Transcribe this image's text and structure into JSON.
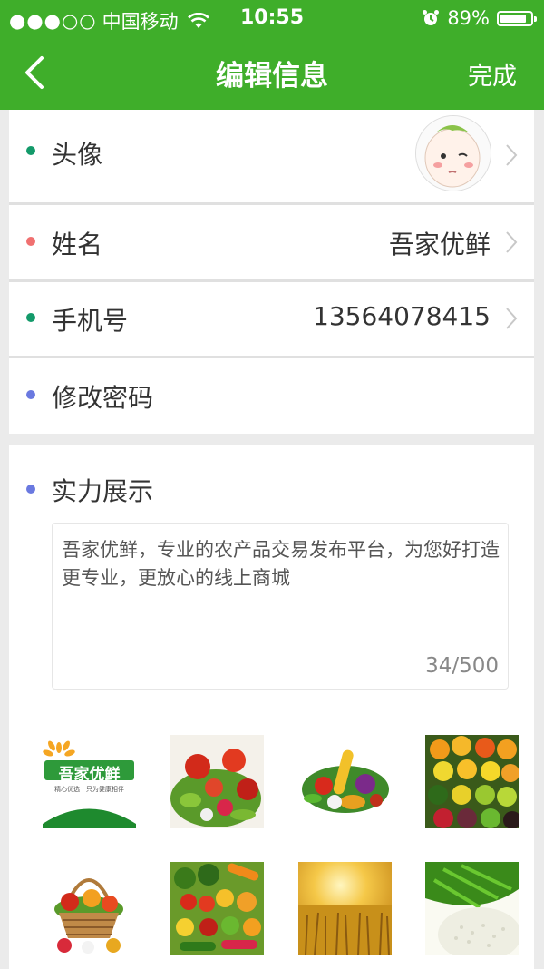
{
  "status_bar": {
    "signal_dots": "●●●○○",
    "carrier": "中国移动",
    "wifi_icon": "wifi-icon",
    "time": "10:55",
    "alarm_icon": "alarm-icon",
    "battery": "89%",
    "battery_level": 0.89
  },
  "nav": {
    "back_icon": "chevron-left-icon",
    "title": "编辑信息",
    "done_label": "完成"
  },
  "profile": {
    "rows": [
      {
        "label": "头像",
        "dot_color": "#139a6a",
        "value": "",
        "icon": "avatar"
      },
      {
        "label": "姓名",
        "dot_color": "#f07070",
        "value": "吾家优鲜"
      },
      {
        "label": "手机号",
        "dot_color": "#139a6a",
        "value": "13564078415"
      },
      {
        "label": "修改密码",
        "dot_color": "#6a79e0",
        "value": ""
      }
    ]
  },
  "showcase": {
    "label": "实力展示",
    "dot_color": "#6a79e0",
    "description": "吾家优鲜，专业的农产品交易发布平台，为您好打造更专业，更放心的线上商城",
    "counter": "34/500",
    "logo_title": "吾家优鲜",
    "logo_tagline": "精心优选 · 只为健康相伴",
    "images": [
      "logo-thumbnail",
      "vegetables-image",
      "vegetable-assortment-image",
      "fruit-assortment-image",
      "fruit-basket-image",
      "produce-pile-image",
      "wheat-field-image",
      "rice-image"
    ]
  },
  "colors": {
    "brand_green": "#3fae2a",
    "page_bg": "#ebebeb"
  }
}
